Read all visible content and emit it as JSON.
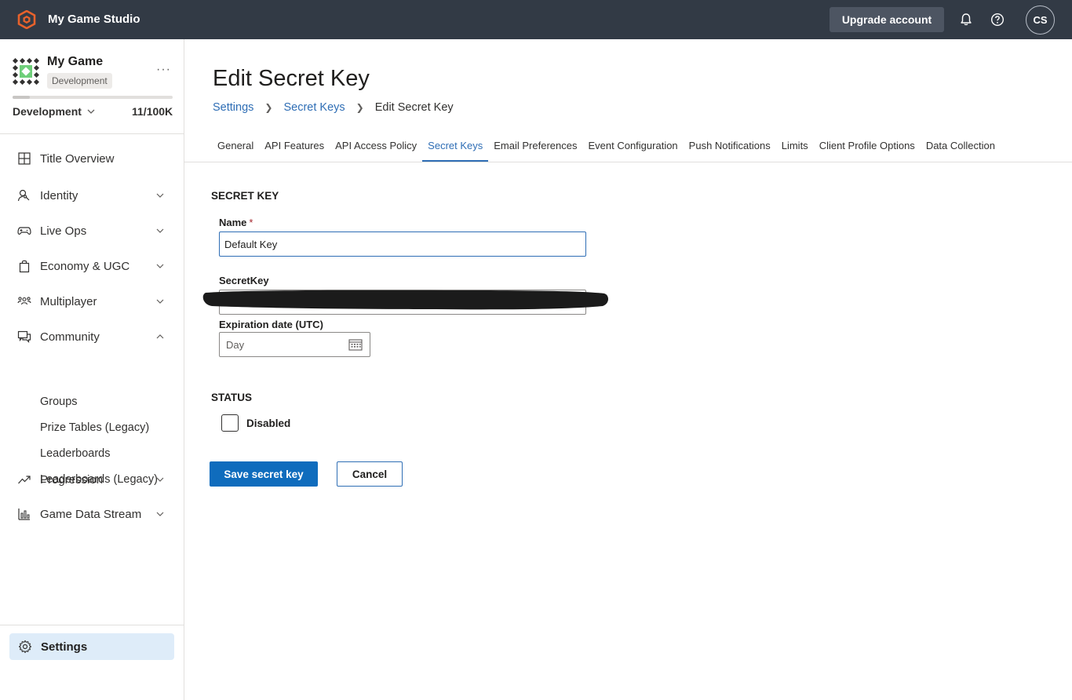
{
  "topbar": {
    "studio_name": "My Game Studio",
    "upgrade_label": "Upgrade account",
    "avatar_initials": "CS"
  },
  "sidebar": {
    "game_name": "My Game",
    "env_badge": "Development",
    "env_selector": "Development",
    "usage_text": "11/100K",
    "usage_fraction": 0.11,
    "nav": [
      {
        "label": "Title Overview",
        "icon": "grid-icon",
        "expandable": false
      },
      {
        "label": "Identity",
        "icon": "identity-icon",
        "expandable": true,
        "expanded": false
      },
      {
        "label": "Live Ops",
        "icon": "gamepad-icon",
        "expandable": true,
        "expanded": false
      },
      {
        "label": "Economy & UGC",
        "icon": "shopping-bag-icon",
        "expandable": true,
        "expanded": false
      },
      {
        "label": "Multiplayer",
        "icon": "people-icon",
        "expandable": true,
        "expanded": false
      },
      {
        "label": "Community",
        "icon": "chat-icon",
        "expandable": true,
        "expanded": true
      },
      {
        "label": "Progression",
        "icon": "trend-icon",
        "expandable": true,
        "expanded": false
      },
      {
        "label": "Game Data Stream",
        "icon": "bar-chart-icon",
        "expandable": true,
        "expanded": false
      }
    ],
    "community_sub": [
      "Groups",
      "Prize Tables (Legacy)",
      "Leaderboards",
      "Leaderboards (Legacy)"
    ],
    "settings_label": "Settings"
  },
  "main": {
    "title": "Edit Secret Key",
    "breadcrumb": {
      "crumb1": "Settings",
      "crumb2": "Secret Keys",
      "current": "Edit Secret Key"
    },
    "tabs": [
      "General",
      "API Features",
      "API Access Policy",
      "Secret Keys",
      "Email Preferences",
      "Event Configuration",
      "Push Notifications",
      "Limits",
      "Client Profile Options",
      "Data Collection"
    ],
    "active_tab": "Secret Keys",
    "form": {
      "section_title": "SECRET KEY",
      "name_label": "Name",
      "name_required": "*",
      "name_value": "Default Key",
      "secret_label": "SecretKey",
      "expiration_label": "Expiration date (UTC)",
      "expiration_placeholder": "Day",
      "status_title": "STATUS",
      "disabled_label": "Disabled",
      "disabled_checked": false,
      "save_label": "Save secret key",
      "cancel_label": "Cancel"
    }
  },
  "colors": {
    "topbar_bg": "#323a45",
    "accent": "#0f6cbd",
    "link": "#2f6eb5",
    "brand_orange": "#e8622c"
  }
}
